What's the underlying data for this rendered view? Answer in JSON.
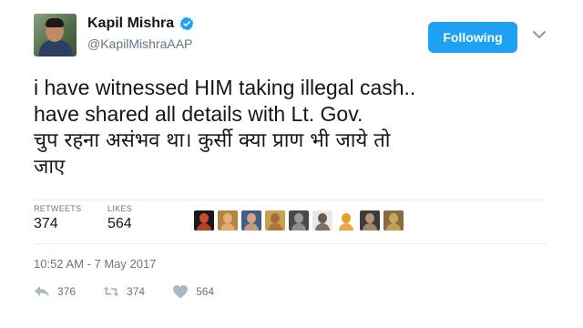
{
  "author": {
    "name": "Kapil Mishra",
    "handle": "@KapilMishraAAP"
  },
  "follow_button": {
    "label": "Following"
  },
  "tweet": {
    "lines": [
      "i have witnessed HIM taking illegal cash..",
      "have shared all details with Lt. Gov.",
      "चुप रहना असंभव था। कुर्सी क्या प्राण भी जाये तो",
      "जाए"
    ]
  },
  "stats": {
    "retweets_label": "RETWEETS",
    "retweets_value": "374",
    "likes_label": "LIKES",
    "likes_value": "564"
  },
  "likers": [
    {
      "icon": "liker-avatar-1",
      "bg": "#1a1a1a",
      "fg": "#d04a2f"
    },
    {
      "icon": "liker-avatar-2",
      "bg": "#b4853e",
      "fg": "#e7b07a"
    },
    {
      "icon": "liker-avatar-3",
      "bg": "#3f5e8c",
      "fg": "#d8a27e"
    },
    {
      "icon": "liker-avatar-4",
      "bg": "#c7a24d",
      "fg": "#a86a44"
    },
    {
      "icon": "liker-avatar-5",
      "bg": "#4a4a4a",
      "fg": "#9a9a9a"
    },
    {
      "icon": "liker-avatar-6",
      "bg": "#e9e9e9",
      "fg": "#6b5a4e"
    },
    {
      "icon": "liker-avatar-7",
      "bg": "#ffffff",
      "fg": "#e89a2b"
    },
    {
      "icon": "liker-avatar-8",
      "bg": "#3b3b3b",
      "fg": "#b89477"
    },
    {
      "icon": "liker-avatar-9",
      "bg": "#8a6d3e",
      "fg": "#c9a55f"
    }
  ],
  "timestamp": "10:52 AM - 7 May 2017",
  "actions": {
    "reply_count": "376",
    "retweet_count": "374",
    "like_count": "564"
  },
  "colors": {
    "accent": "#1da1f2",
    "muted": "#657786"
  }
}
